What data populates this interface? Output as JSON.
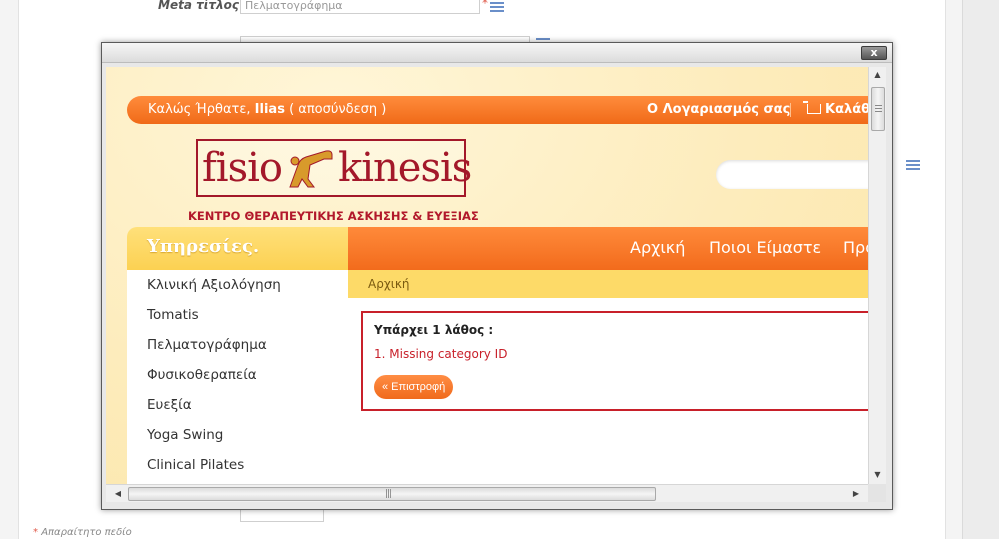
{
  "background": {
    "meta_title_label": "Meta τίτλος",
    "meta_title_value": "Πελματογράφημα",
    "meta_title_required": "*",
    "required_note_star": "*",
    "required_note": "Απαραίτητο πεδίο"
  },
  "modal": {
    "close_label": "x"
  },
  "site": {
    "topbar": {
      "welcome_text": "Καλώς Ήρθατε,",
      "username": "Ilias",
      "logout_text": "( αποσύνδεση )",
      "account_label": "Ο Λογαριασμός σας",
      "cart_label": "Καλάθι"
    },
    "logo": {
      "word_left": "fisio",
      "word_right": "kinesis",
      "tagline": "ΚΕΝΤΡΟ ΘΕΡΑΠΕΥΤΙΚΗΣ ΑΣΚΗΣΗΣ & ΕΥΕΞΙΑΣ"
    },
    "services_heading": "Υπηρεσίες.",
    "nav": [
      "Αρχική",
      "Ποιοι Είμαστε",
      "Προ"
    ],
    "breadcrumb": "Αρχική",
    "sidebar_items": [
      "Κλινική Αξιολόγηση",
      "Tomatis",
      "Πελματογράφημα",
      "Φυσικοθεραπεία",
      "Ευεξία",
      "Yoga Swing",
      "Clinical Pilates"
    ],
    "error": {
      "title": "Υπάρχει 1 λάθος :",
      "message": "1.  Missing category ID",
      "back_label": "« Επιστροφή"
    }
  },
  "colors": {
    "accent_orange": "#f26b1c",
    "accent_yellow": "#fdda68",
    "brand_red": "#a3182a",
    "error_red": "#c8202a"
  }
}
